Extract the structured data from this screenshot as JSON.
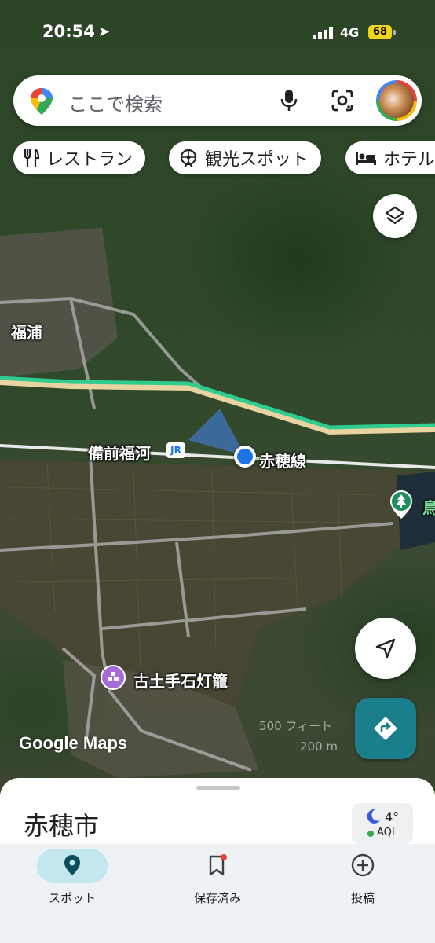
{
  "status_bar": {
    "time": "20:54",
    "network": "4G",
    "battery": "68"
  },
  "search": {
    "placeholder": "ここで検索"
  },
  "chips": [
    {
      "label": "レストラン",
      "icon": "restaurant-icon"
    },
    {
      "label": "観光スポット",
      "icon": "attraction-icon"
    },
    {
      "label": "ホテル",
      "icon": "hotel-icon"
    }
  ],
  "map": {
    "labels": {
      "town": "福浦",
      "station": "備前福河",
      "station_badge": "JR",
      "line": "赤穂線",
      "landmark": "古土手石灯籠",
      "park_partial": "鳥"
    },
    "scale": {
      "feet": "500 フィート",
      "meters": "200 m"
    },
    "watermark": "Google Maps"
  },
  "sheet": {
    "city": "赤穂市",
    "weather": {
      "temperature": "4°",
      "aqi": "AQI"
    }
  },
  "navbar": {
    "items": [
      {
        "label": "スポット",
        "icon": "location-pin-icon",
        "active": true
      },
      {
        "label": "保存済み",
        "icon": "bookmark-icon",
        "active": false
      },
      {
        "label": "投稿",
        "icon": "add-circle-icon",
        "active": false
      }
    ]
  },
  "colors": {
    "accent": "#1a7f8a",
    "active_pill": "#c2e7ef",
    "rail_line": "#2ecc8f",
    "location_dot": "#1a73e8"
  }
}
